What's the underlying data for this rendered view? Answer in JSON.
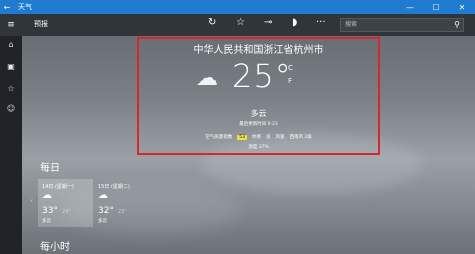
{
  "titlebar": {
    "back": "←",
    "title": "天气",
    "minimize": "—",
    "maximize": "☐",
    "close": "✕"
  },
  "sidebar": [
    {
      "name": "home-icon",
      "glyph": "⌂"
    },
    {
      "name": "map-icon",
      "glyph": "▣"
    },
    {
      "name": "favorites-icon",
      "glyph": "☆"
    },
    {
      "name": "emoji-icon",
      "glyph": "☺"
    }
  ],
  "cmdbar": {
    "menu": "≡",
    "label": "预报",
    "refresh": "↻",
    "favorite": "☆",
    "pin": "⊸",
    "theme": "◗",
    "more": "···",
    "search_placeholder": "搜索",
    "search_icon": "⚲"
  },
  "current": {
    "city": "中华人民共和国浙江省杭州市",
    "icon": "☁",
    "temperature": "25°",
    "unit_c": "C",
    "unit_f": "F",
    "condition": "多云",
    "updated": "最后更新时间 9:23",
    "aqi_label": "空气质量指数",
    "aqi_value": "53",
    "feels_label": "体感",
    "feels_value": "良",
    "wind_label": "风速",
    "wind_value": "西南风 2级",
    "humidity": "湿度 37%"
  },
  "daily": {
    "title": "每日",
    "days": [
      {
        "date": "14日 (星期一)",
        "icon": "☁",
        "high": "33°",
        "low": "24°",
        "cond": "多云"
      },
      {
        "date": "15日 (星期二)",
        "icon": "☁",
        "high": "32°",
        "low": "23°",
        "cond": "多云"
      }
    ],
    "prev": "‹"
  },
  "hourly": {
    "title": "每小时"
  }
}
